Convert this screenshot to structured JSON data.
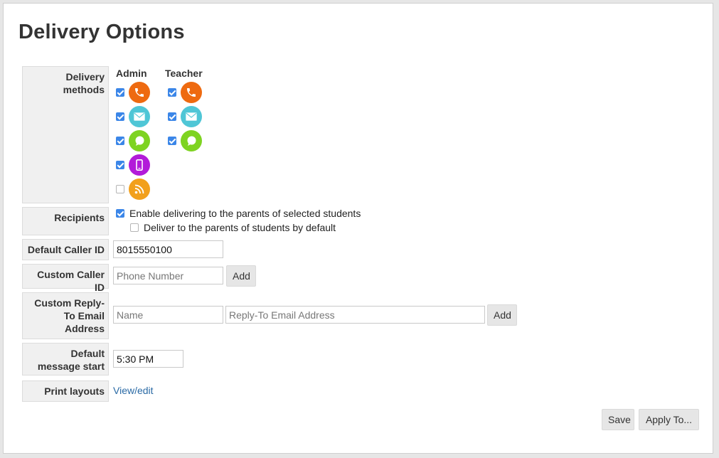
{
  "page": {
    "title": "Delivery Options"
  },
  "delivery_methods": {
    "label": "Delivery methods",
    "admin_header": "Admin",
    "teacher_header": "Teacher",
    "admin": [
      {
        "method": "phone",
        "icon": "phone-icon",
        "color": "#ee6a10",
        "checked": true
      },
      {
        "method": "email",
        "icon": "envelope-icon",
        "color": "#4fc6d6",
        "checked": true
      },
      {
        "method": "sms",
        "icon": "chat-bubble-icon",
        "color": "#7ed321",
        "checked": true
      },
      {
        "method": "push",
        "icon": "mobile-icon",
        "color": "#b21bd9",
        "checked": true
      },
      {
        "method": "rss",
        "icon": "rss-icon",
        "color": "#f2a01c",
        "checked": false
      }
    ],
    "teacher": [
      {
        "method": "phone",
        "icon": "phone-icon",
        "color": "#ee6a10",
        "checked": true
      },
      {
        "method": "email",
        "icon": "envelope-icon",
        "color": "#4fc6d6",
        "checked": true
      },
      {
        "method": "sms",
        "icon": "chat-bubble-icon",
        "color": "#7ed321",
        "checked": true
      }
    ]
  },
  "recipients": {
    "label": "Recipients",
    "enable_parents": {
      "text": "Enable delivering to the parents of selected students",
      "checked": true
    },
    "parents_default": {
      "text": "Deliver to the parents of students by default",
      "checked": false
    }
  },
  "default_caller_id": {
    "label": "Default Caller ID",
    "value": "8015550100"
  },
  "custom_caller_id": {
    "label": "Custom Caller ID",
    "placeholder": "Phone Number",
    "add_label": "Add"
  },
  "custom_reply_to": {
    "label": "Custom Reply-To Email Address",
    "name_placeholder": "Name",
    "email_placeholder": "Reply-To Email Address",
    "add_label": "Add"
  },
  "default_message_start": {
    "label": "Default message start",
    "value": "5:30 PM"
  },
  "print_layouts": {
    "label": "Print layouts",
    "link_text": "View/edit"
  },
  "footer": {
    "save_label": "Save",
    "apply_label": "Apply To..."
  },
  "colors": {
    "accent": "#3b86e8",
    "link": "#2a6aa5",
    "label_bg": "#f0f0f0"
  }
}
